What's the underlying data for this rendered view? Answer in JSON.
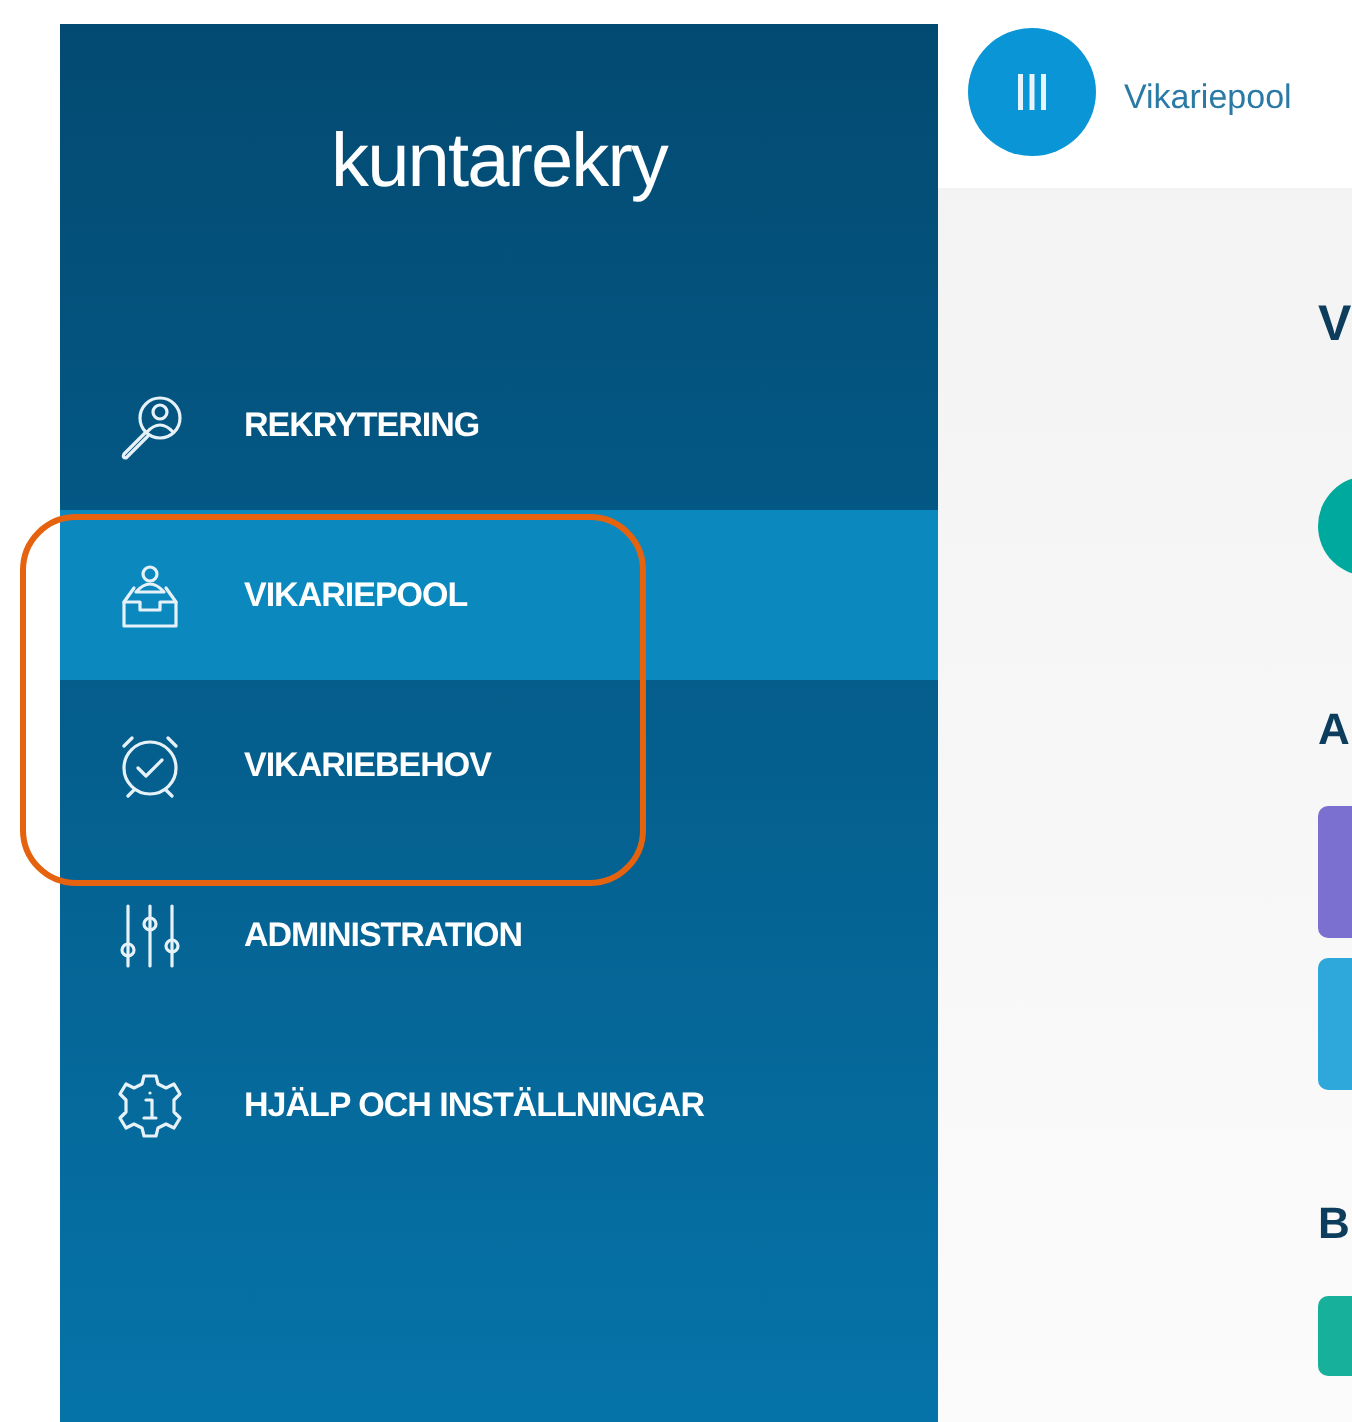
{
  "logo": {
    "text": "kuntarekry"
  },
  "nav": {
    "items": [
      {
        "label": "REKRYTERING",
        "kind": "search-person",
        "selected": false
      },
      {
        "label": "VIKARIEPOOL",
        "kind": "inbox-person",
        "selected": true
      },
      {
        "label": "VIKARIEBEHOV",
        "kind": "alarm-check",
        "selected": false
      },
      {
        "label": "ADMINISTRATION",
        "kind": "sliders",
        "selected": false
      },
      {
        "label": "HJÄLP OCH INSTÄLLNINGAR",
        "kind": "info-gear",
        "selected": false
      }
    ]
  },
  "header": {
    "title": "Vikariepool"
  },
  "content": {
    "heading": "V",
    "section_1": {
      "title": "A",
      "cards": [
        {
          "color": "#7b6fd0"
        },
        {
          "color": "#2ea8db"
        }
      ]
    },
    "section_2": {
      "title": "B"
    }
  }
}
